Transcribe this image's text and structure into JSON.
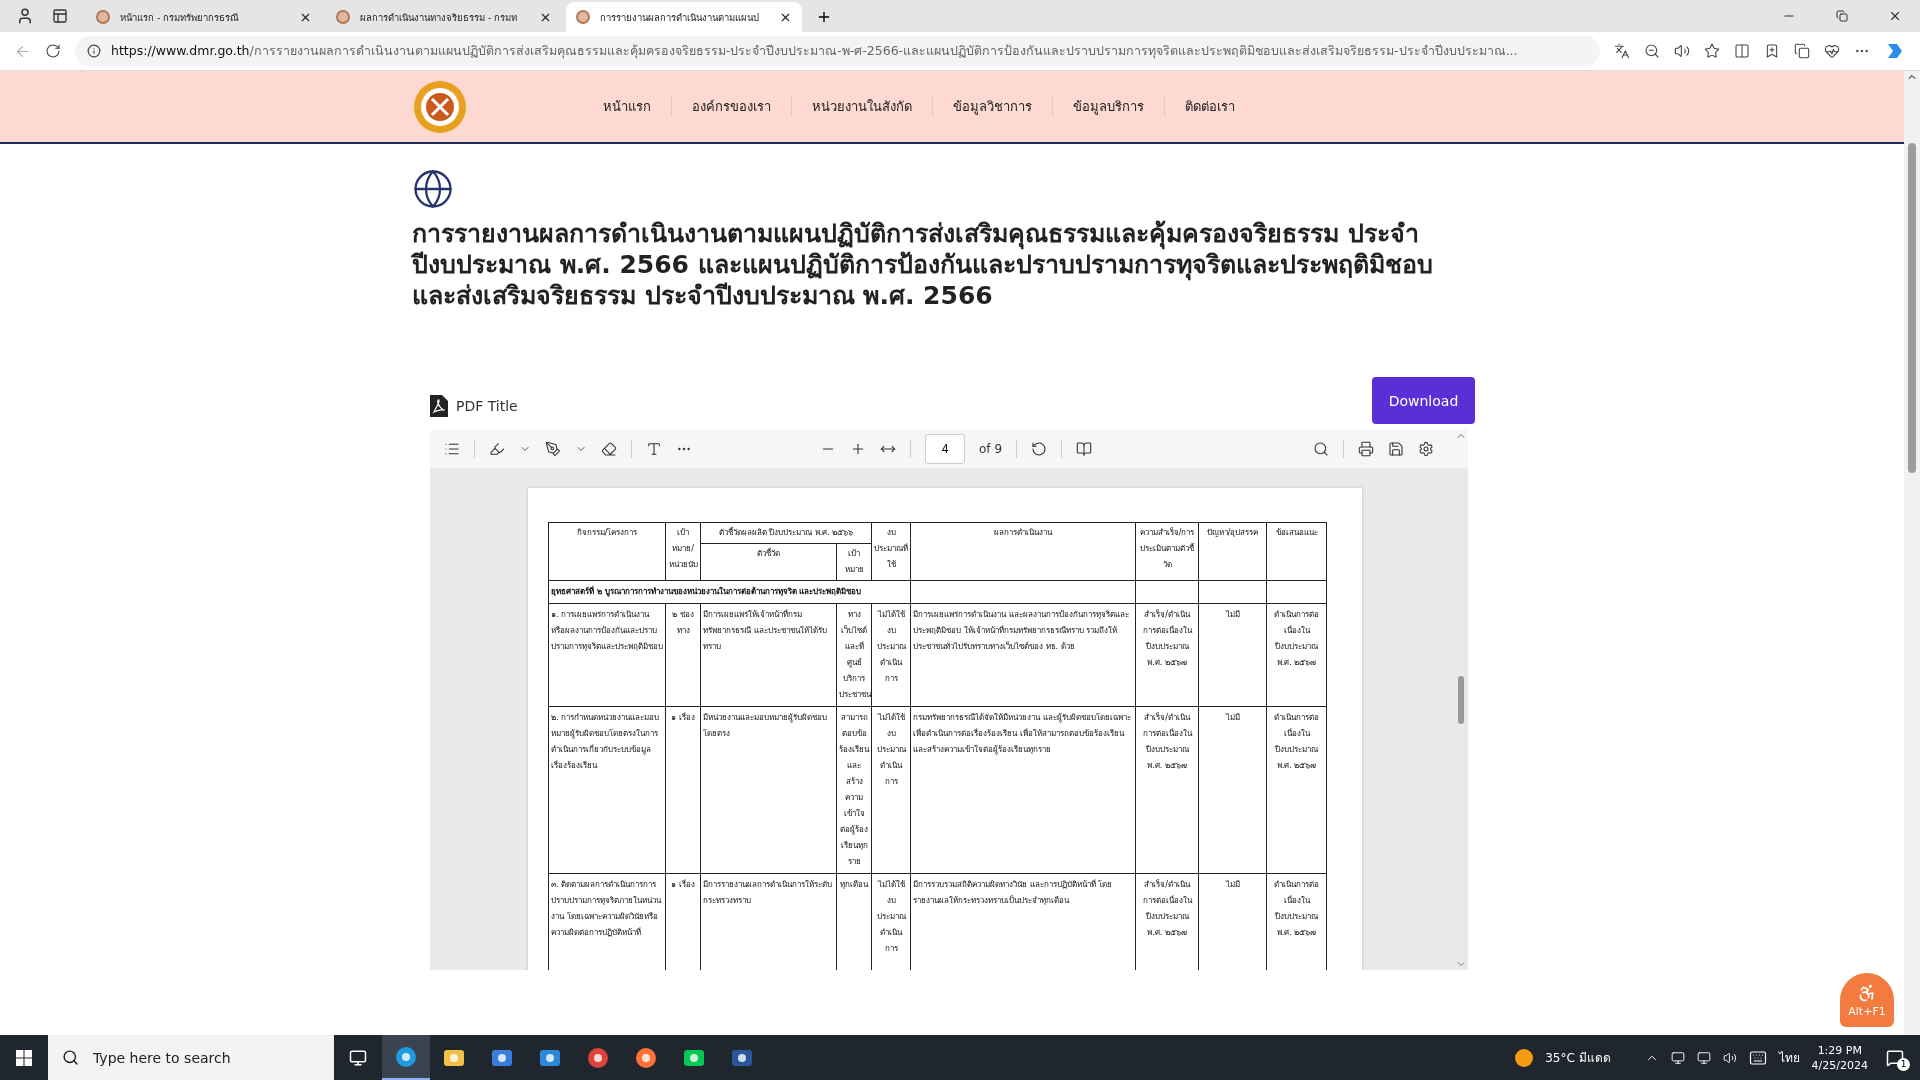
{
  "browser": {
    "tabs": [
      {
        "title": "หน้าแรก - กรมทรัพยากรธรณี",
        "selected": false
      },
      {
        "title": "ผลการดำเนินงานทางจริยธรรม - กรมท",
        "selected": false
      },
      {
        "title": "การรายงานผลการดำเนินงานตามแผนป",
        "selected": true
      }
    ],
    "address": {
      "domain": "https://www.dmr.go.th",
      "path": "/การรายงานผลการดำเนินงานตามแผนปฏิบัติการส่งเสริมคุณธรรมและคุ้มครองจริยธรรม-ประจำปีงบประมาณ-พ-ศ-2566-และแผนปฏิบัติการป้องกันและปราบปรามการทุจริตและประพฤติมิชอบและส่งเสริมจริยธรรม-ประจำปีงบประมาณ..."
    }
  },
  "site": {
    "nav": [
      "หน้าแรก",
      "องค์กรของเรา",
      "หน่วยงานในสังกัด",
      "ข้อมูลวิชาการ",
      "ข้อมูลบริการ",
      "ติดต่อเรา"
    ],
    "title": "การรายงานผลการดำเนินงานตามแผนปฏิบัติการส่งเสริมคุณธรรมและคุ้มครองจริยธรรม ประจำปีงบประมาณ พ.ศ. 2566 และแผนปฏิบัติการป้องกันและปราบปรามการทุจริตและประพฤติมิชอบและส่งเสริมจริยธรรม ประจำปีงบประมาณ พ.ศ. 2566"
  },
  "pdf": {
    "title": "PDF Title",
    "download": "Download",
    "page": "4",
    "page_count": "of 9"
  },
  "document": {
    "header": {
      "activity": "กิจกรรม/โครงการ",
      "unit": "เป้าหมาย/หน่วยนับ",
      "indicator_group": "ตัวชี้วัดผลผลิต ปีงบประมาณ พ.ศ. ๒๕๖๖",
      "indicator": "ตัวชี้วัด",
      "target": "เป้าหมาย",
      "budget": "งบประมาณที่ใช้",
      "result": "ผลการดำเนินงาน",
      "success": "ความสำเร็จ/การประเมินตามตัวชี้วัด",
      "problem": "ปัญหา/อุปสรรค",
      "suggestion": "ข้อเสนอแนะ"
    },
    "section": "ยุทธศาสตร์ที่ ๒ บูรณาการการทำงานของหน่วยงานในการต่อต้านการทุจริต และประพฤติมิชอบ",
    "rows": [
      {
        "cells": [
          "๑. การเผยแพร่การดำเนินงานหรือผลงานการป้องกันและปราบปรามการทุจริตและประพฤติมิชอบ",
          "๒ ช่องทาง",
          "มีการเผยแพร่ให้เจ้าหน้าที่กรมทรัพยากรธรณี และประชาชนให้ได้รับทราบ",
          "ทางเว็บไซต์และที่ศูนย์บริการประชาชน",
          "ไม่ได้ใช้งบประมาณดำเนินการ",
          "มีการเผยแพร่การดำเนินงาน และผลงานการป้องกันการทุจริตและประพฤติมิชอบ ให้เจ้าหน้าที่กรมทรัพยากรธรณีทราบ รวมถึงให้ประชาชนทั่วไปรับทราบทางเว็บไซต์ของ ทธ. ด้วย",
          "สำเร็จ/ดำเนินการต่อเนื่องในปีงบประมาณ พ.ศ. ๒๕๖๗",
          "ไม่มี",
          "ดำเนินการต่อเนื่องในปีงบประมาณ พ.ศ. ๒๕๖๗"
        ]
      },
      {
        "cells": [
          "๒. การกำหนดหน่วยงานและมอบหมายผู้รับผิดชอบโดยตรงในการดำเนินการเกี่ยวกับระบบข้อมูลเรื่องร้องเรียน",
          "๑ เรื่อง",
          "มีหน่วยงานและมอบหมายผู้รับผิดชอบโดยตรง",
          "สามารถตอบข้อร้องเรียนและสร้างความเข้าใจต่อผู้ร้องเรียนทุกราย",
          "ไม่ได้ใช้งบประมาณดำเนินการ",
          "กรมทรัพยากรธรณีได้จัดให้มีหน่วยงาน และผู้รับผิดชอบโดยเฉพาะ เพื่อดำเนินการต่อเรื่องร้องเรียน เพื่อให้สามารถตอบข้อร้องเรียนและสร้างความเข้าใจต่อผู้ร้องเรียนทุกราย",
          "สำเร็จ/ดำเนินการต่อเนื่องในปีงบประมาณ พ.ศ. ๒๕๖๗",
          "ไม่มี",
          "ดำเนินการต่อเนื่องในปีงบประมาณ พ.ศ. ๒๕๖๗"
        ]
      },
      {
        "cells": [
          "๓. ติดตามผลการดำเนินการการปราบปรามการทุจริตภายในหน่วนงาน โดยเฉพาะความผิดวินัยหรือความผิดต่อการปฏิบัติหน้าที่",
          "๑ เรื่อง",
          "มีการรายงานผลการดำเนินการให้ระดับกระทรวงทราบ",
          "ทุกเดือน",
          "ไม่ได้ใช้งบประมาณดำเนินการ",
          "มีการรวบรวมสถิติความผิดทางวินัย และการปฏิบัติหน้าที่ โดยรายงานผลให้กระทรวงทราบเป็นประจำทุกเดือน",
          "สำเร็จ/ดำเนินการต่อเนื่องในปีงบประมาณ พ.ศ. ๒๕๖๗",
          "ไม่มี",
          "ดำเนินการต่อเนื่องในปีงบประมาณ พ.ศ. ๒๕๖๗"
        ]
      }
    ]
  },
  "accessibility": {
    "label": "Alt+F1"
  },
  "taskbar": {
    "search_placeholder": "Type here to search",
    "weather": "35°C มีแดด",
    "language": "ไทย",
    "time": "1:29 PM",
    "date": "4/25/2024",
    "notifications": "1"
  }
}
